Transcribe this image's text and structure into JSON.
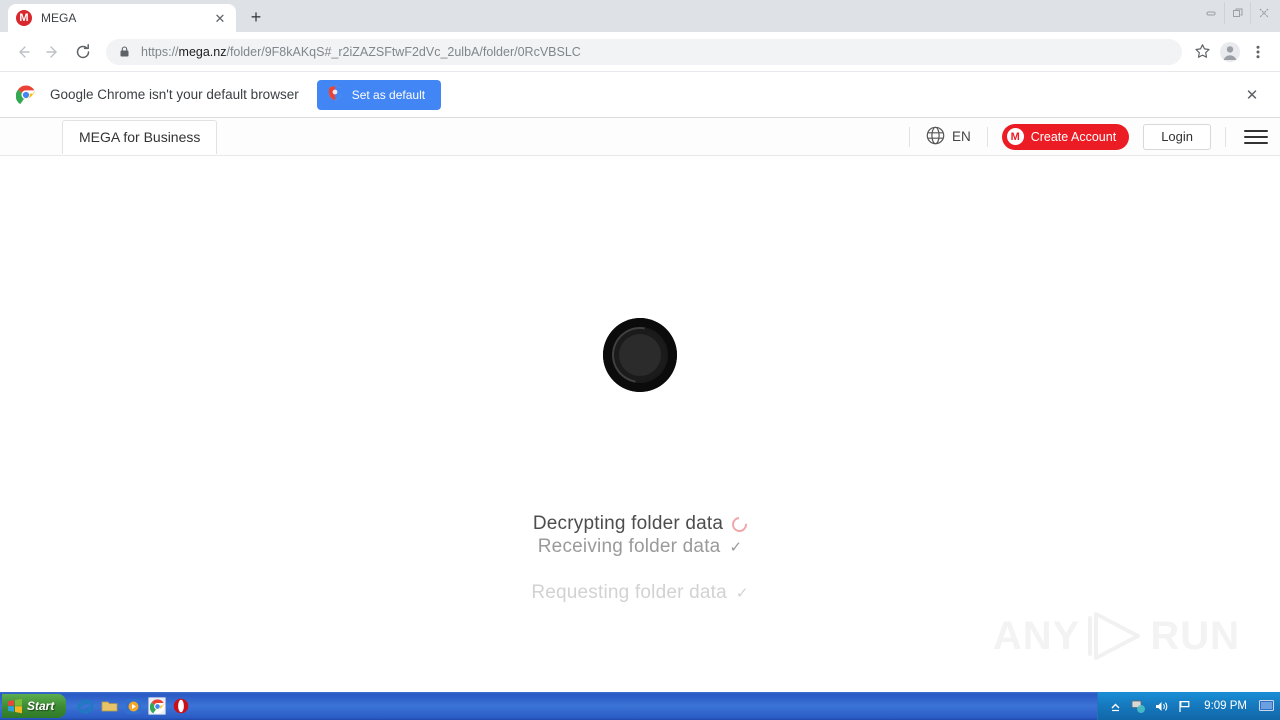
{
  "browser": {
    "tab": {
      "title": "MEGA",
      "favicon": "mega-logo-icon",
      "close": "✕"
    },
    "new_tab_label": "+",
    "window_controls": {
      "minimize": "minimize-icon",
      "restore": "restore-icon",
      "close": "close-icon"
    },
    "nav": {
      "back": "back-arrow-icon",
      "forward": "forward-arrow-icon",
      "reload": "reload-icon"
    },
    "omnibox": {
      "lock": "lock-icon",
      "scheme": "https://",
      "domain": "mega.nz",
      "path": "/folder/9F8kAKqS#_r2iZAZSFtwF2dVc_2ulbA/folder/0RcVBSLC",
      "full_url": "https://mega.nz/folder/9F8kAKqS#_r2iZAZSFtwF2dVc_2ulbA/folder/0RcVBSLC"
    },
    "toolbar_icons": {
      "bookmark": "star-icon",
      "profile": "avatar-icon",
      "menu": "three-dot-menu-icon"
    }
  },
  "infobar": {
    "logo": "chrome-logo-icon",
    "message": "Google Chrome isn't your default browser",
    "button_label": "Set as default",
    "button_icon": "shield-icon",
    "button_color": "#4285f4",
    "close": "✕"
  },
  "mega": {
    "business_tab": "MEGA for Business",
    "language": {
      "icon": "globe-icon",
      "code": "EN"
    },
    "create_account": {
      "label": "Create Account",
      "logo": "mega-logo-icon",
      "color": "#eb1c24"
    },
    "login": "Login",
    "menu": "hamburger-menu-icon",
    "loader": {
      "icon": "loading-spinner-icon"
    },
    "status": [
      {
        "label": "Decrypting folder data",
        "state": "in-progress",
        "indicator": "spinner-icon"
      },
      {
        "label": "Receiving folder data",
        "state": "done",
        "indicator": "✓"
      },
      {
        "label": "Requesting folder data",
        "state": "done",
        "indicator": "✓"
      }
    ],
    "watermark": {
      "left": "ANY",
      "right": "RUN",
      "icon": "play-triangle-icon"
    }
  },
  "taskbar": {
    "start_label": "Start",
    "quick_launch": [
      {
        "name": "internet-explorer-icon"
      },
      {
        "name": "file-explorer-icon"
      },
      {
        "name": "media-player-icon"
      },
      {
        "name": "chrome-icon"
      },
      {
        "name": "opera-icon"
      }
    ],
    "tray": [
      {
        "name": "show-hidden-icons-icon"
      },
      {
        "name": "network-icon"
      },
      {
        "name": "volume-icon"
      },
      {
        "name": "flag-icon"
      }
    ],
    "clock": "9:09 PM",
    "show-desktop": "show-desktop-icon"
  }
}
